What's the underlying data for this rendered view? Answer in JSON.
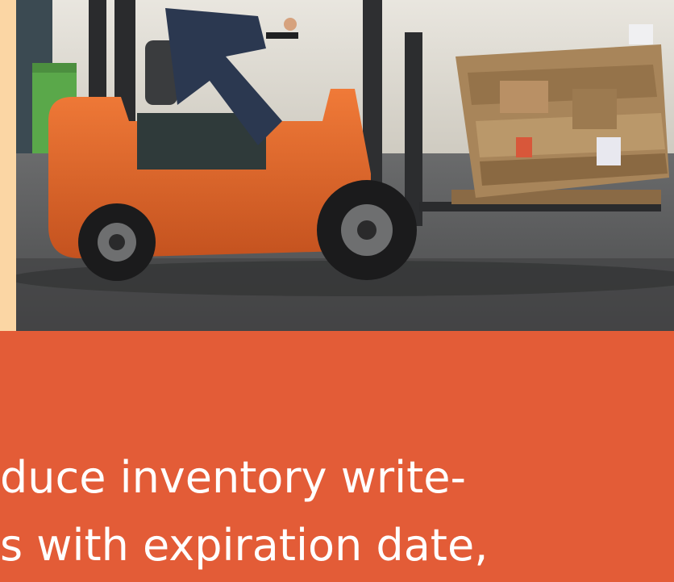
{
  "caption": {
    "line1": "duce inventory write-",
    "line2": "s with expiration date,"
  },
  "colors": {
    "banner": "#e35c37",
    "strip": "#fbd6a4",
    "text": "#ffffff",
    "forklift": "#e2692f"
  },
  "image": {
    "subject": "forklift-carrying-cardboard-bale-icon"
  }
}
